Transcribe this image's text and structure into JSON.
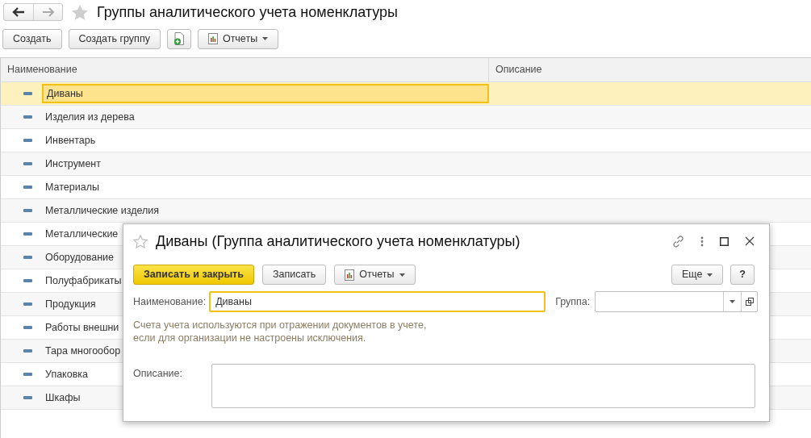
{
  "window": {
    "title": "Группы аналитического учета номенклатуры"
  },
  "toolbar": [
    {
      "kind": "text",
      "label": "Создать"
    },
    {
      "kind": "text",
      "label": "Создать группу"
    },
    {
      "kind": "icon"
    },
    {
      "kind": "menu",
      "label": "Отчеты"
    }
  ],
  "table": {
    "columns": [
      "Наименование",
      "Описание"
    ],
    "rows": [
      {
        "name": "Диваны",
        "selected": true
      },
      {
        "name": "Изделия из дерева",
        "selected": false
      },
      {
        "name": "Инвентарь",
        "selected": false
      },
      {
        "name": "Инструмент",
        "selected": false
      },
      {
        "name": "Материалы",
        "selected": false
      },
      {
        "name": "Металлические изделия",
        "selected": false
      },
      {
        "name": "Металлические",
        "selected": false
      },
      {
        "name": "Оборудование",
        "selected": false
      },
      {
        "name": "Полуфабрикаты",
        "selected": false
      },
      {
        "name": "Продукция",
        "selected": false
      },
      {
        "name": "Работы внешни",
        "selected": false
      },
      {
        "name": "Тара многообор",
        "selected": false
      },
      {
        "name": "Упаковка",
        "selected": false
      },
      {
        "name": "Шкафы",
        "selected": false
      }
    ]
  },
  "dialog": {
    "title": "Диваны (Группа аналитического учета номенклатуры)",
    "buttons": [
      {
        "kind": "primary",
        "label": "Записать и закрыть"
      },
      {
        "kind": "text",
        "label": "Записать"
      },
      {
        "kind": "menu",
        "label": "Отчеты"
      }
    ],
    "right_buttons": [
      {
        "kind": "more",
        "label": "Еще"
      },
      {
        "kind": "help",
        "label": "?"
      }
    ],
    "name_label": "Наименование:",
    "name_value": "Диваны",
    "group_label": "Группа:",
    "hint": "Счета учета используются при отражении документов в учете,\nесли для организации не настроены исключения.",
    "description_label": "Описание:"
  }
}
